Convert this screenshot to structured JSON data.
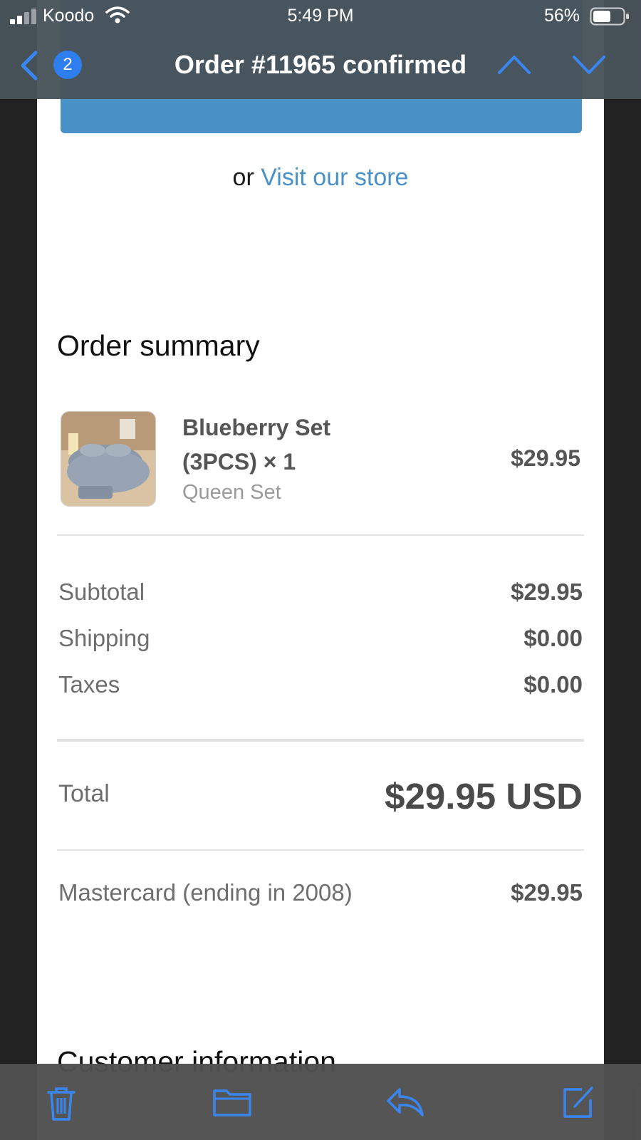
{
  "status_bar": {
    "carrier": "Koodo",
    "time": "5:49 PM",
    "battery": "56%"
  },
  "nav": {
    "badge_count": "2",
    "title": "Order #11965 confirmed"
  },
  "email": {
    "visit_prefix": "or",
    "visit_link": "Visit our store",
    "summary_title": "Order summary",
    "item": {
      "name": "Blueberry Set (3PCS) × 1",
      "variant": "Queen Set",
      "price": "$29.95"
    },
    "subtotal_label": "Subtotal",
    "subtotal_value": "$29.95",
    "shipping_label": "Shipping",
    "shipping_value": "$0.00",
    "taxes_label": "Taxes",
    "taxes_value": "$0.00",
    "total_label": "Total",
    "total_value": "$29.95 USD",
    "payment_label": "Mastercard (ending in 2008)",
    "payment_value": "$29.95",
    "customer_info_title": "Customer information"
  },
  "colors": {
    "accent_blue": "#4a91c8",
    "ios_blue": "#2f7ef0",
    "nav_bg": "#48525a",
    "toolbar_bg": "#505050",
    "toolbar_icon": "#3a86f0"
  },
  "icons": {
    "back": "chevron-left-icon",
    "up": "chevron-up-icon",
    "down": "chevron-down-icon",
    "trash": "trash-icon",
    "folder": "folder-icon",
    "reply": "reply-icon",
    "compose": "compose-icon"
  }
}
